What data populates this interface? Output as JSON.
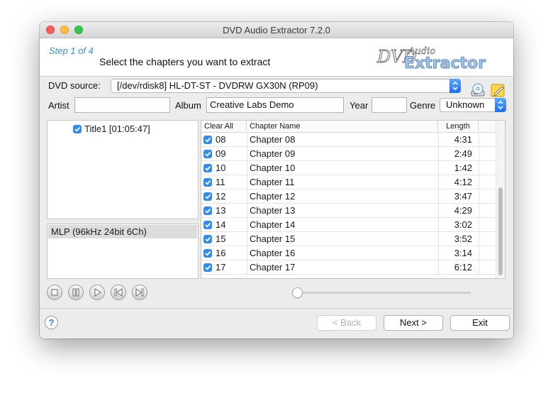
{
  "window": {
    "title": "DVD Audio Extractor 7.2.0"
  },
  "header": {
    "step_text": "Step 1 of 4",
    "instruction": "Select the chapters you want to extract",
    "logo_text_top": "DVD",
    "logo_text_script": "Audio",
    "logo_text_main": "Extractor"
  },
  "source": {
    "label": "DVD source:",
    "value": "[/dev/rdisk8]  HL-DT-ST - DVDRW  GX30N (RP09)"
  },
  "meta": {
    "artist_label": "Artist",
    "artist_value": "",
    "album_label": "Album",
    "album_value": "Creative Labs Demo",
    "year_label": "Year",
    "year_value": "",
    "genre_label": "Genre",
    "genre_value": "Unknown"
  },
  "tree": {
    "title_item": "Title1 [01:05:47]"
  },
  "streams": {
    "selected": "MLP (96kHz 24bit 6Ch)"
  },
  "table": {
    "headers": {
      "check": "Clear All",
      "name": "Chapter Name",
      "length": "Length"
    },
    "rows": [
      {
        "num": "08",
        "name": "Chapter 08",
        "length": "4:31"
      },
      {
        "num": "09",
        "name": "Chapter 09",
        "length": "2:49"
      },
      {
        "num": "10",
        "name": "Chapter 10",
        "length": "1:42"
      },
      {
        "num": "11",
        "name": "Chapter 11",
        "length": "4:12"
      },
      {
        "num": "12",
        "name": "Chapter 12",
        "length": "3:47"
      },
      {
        "num": "13",
        "name": "Chapter 13",
        "length": "4:29"
      },
      {
        "num": "14",
        "name": "Chapter 14",
        "length": "3:02"
      },
      {
        "num": "15",
        "name": "Chapter 15",
        "length": "3:52"
      },
      {
        "num": "16",
        "name": "Chapter 16",
        "length": "3:14"
      },
      {
        "num": "17",
        "name": "Chapter 17",
        "length": "6:12"
      }
    ]
  },
  "player": {
    "position": 0
  },
  "buttons": {
    "help": "?",
    "back": "< Back",
    "next": "Next >",
    "exit": "Exit"
  },
  "colors": {
    "accent": "#2f8cf3",
    "step": "#3d8fd4"
  }
}
